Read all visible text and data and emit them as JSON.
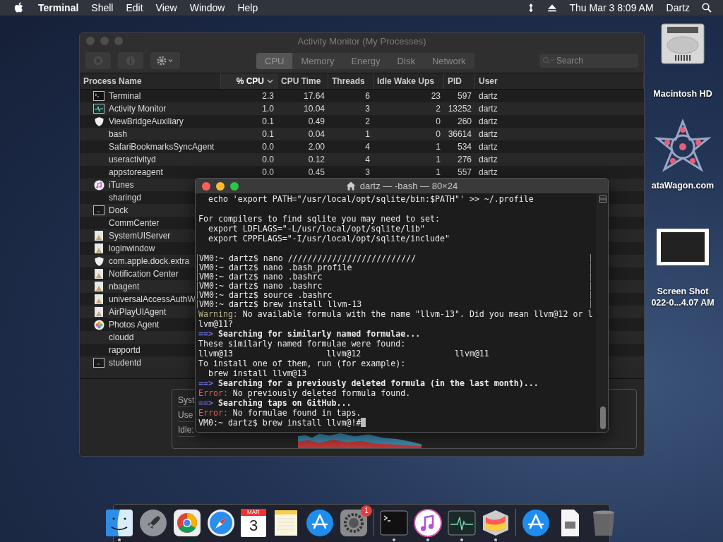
{
  "menu_bar": {
    "app_name": "Terminal",
    "menus": [
      "Shell",
      "Edit",
      "View",
      "Window",
      "Help"
    ],
    "clock": "Thu Mar 3  8:09 AM",
    "user": "Dartz"
  },
  "activity_monitor": {
    "title": "Activity Monitor (My Processes)",
    "tabs": [
      {
        "label": "CPU",
        "selected": true
      },
      {
        "label": "Memory",
        "selected": false
      },
      {
        "label": "Energy",
        "selected": false
      },
      {
        "label": "Disk",
        "selected": false
      },
      {
        "label": "Network",
        "selected": false
      }
    ],
    "search": {
      "placeholder": "Search"
    },
    "columns": [
      {
        "label": "Process Name",
        "sorted": false
      },
      {
        "label": "% CPU",
        "sorted": true
      },
      {
        "label": "CPU Time",
        "sorted": false
      },
      {
        "label": "Threads",
        "sorted": false
      },
      {
        "label": "Idle Wake Ups",
        "sorted": false
      },
      {
        "label": "PID",
        "sorted": false
      },
      {
        "label": "User",
        "sorted": false
      }
    ],
    "rows": [
      {
        "name": "Terminal",
        "kind": "terminal",
        "cells": [
          "2.3",
          "17.64",
          "6",
          "23",
          "597",
          "dartz"
        ]
      },
      {
        "name": "Activity Monitor",
        "kind": "activity",
        "cells": [
          "1.0",
          "10.04",
          "3",
          "2",
          "13252",
          "dartz"
        ]
      },
      {
        "name": "ViewBridgeAuxiliary",
        "kind": "shield",
        "cells": [
          "0.1",
          "0.49",
          "2",
          "0",
          "260",
          "dartz"
        ]
      },
      {
        "name": "bash",
        "kind": "none",
        "cells": [
          "0.1",
          "0.04",
          "1",
          "0",
          "36614",
          "dartz"
        ]
      },
      {
        "name": "SafariBookmarksSyncAgent",
        "kind": "none",
        "cells": [
          "0.0",
          "2.00",
          "4",
          "1",
          "534",
          "dartz"
        ]
      },
      {
        "name": "useractivityd",
        "kind": "none",
        "cells": [
          "0.0",
          "0.12",
          "4",
          "1",
          "276",
          "dartz"
        ]
      },
      {
        "name": "appstoreagent",
        "kind": "none",
        "cells": [
          "0.0",
          "0.45",
          "3",
          "1",
          "557",
          "dartz"
        ]
      },
      {
        "name": "iTunes",
        "kind": "music"
      },
      {
        "name": "sharingd",
        "kind": "none"
      },
      {
        "name": "Dock",
        "kind": "window"
      },
      {
        "name": "CommCenter",
        "kind": "none"
      },
      {
        "name": "SystemUIServer",
        "kind": "app"
      },
      {
        "name": "loginwindow",
        "kind": "app"
      },
      {
        "name": "com.apple.dock.extra",
        "kind": "shield"
      },
      {
        "name": "Notification Center",
        "kind": "app"
      },
      {
        "name": "nbagent",
        "kind": "app"
      },
      {
        "name": "universalAccessAuthW",
        "kind": "app"
      },
      {
        "name": "AirPlayUIAgent",
        "kind": "app"
      },
      {
        "name": "Photos Agent",
        "kind": "photos"
      },
      {
        "name": "cloudd",
        "kind": "none"
      },
      {
        "name": "rapportd",
        "kind": "none"
      },
      {
        "name": "studentd",
        "kind": "window"
      }
    ],
    "summary_labels": [
      "Syst",
      "Use",
      "Idle:"
    ]
  },
  "terminal": {
    "title": "dartz — -bash — 80×24",
    "lines": [
      {
        "kind": "text",
        "marked": false,
        "segments": [
          {
            "text": "  echo 'export PATH=\"/usr/local/opt/sqlite/bin:$PATH\"' >> ~/.profile",
            "kind": "plain"
          }
        ]
      },
      {
        "kind": "blank"
      },
      {
        "kind": "text",
        "marked": false,
        "segments": [
          {
            "text": "For compilers to find sqlite you may need to set:",
            "kind": "plain"
          }
        ]
      },
      {
        "kind": "text",
        "marked": false,
        "segments": [
          {
            "text": "  export LDFLAGS=\"-L/usr/local/opt/sqlite/lib\"",
            "kind": "plain"
          }
        ]
      },
      {
        "kind": "text",
        "marked": false,
        "segments": [
          {
            "text": "  export CPPFLAGS=\"-I/usr/local/opt/sqlite/include\"",
            "kind": "plain"
          }
        ]
      },
      {
        "kind": "blank"
      },
      {
        "kind": "text",
        "marked": true,
        "segments": [
          {
            "text": "VM0:~ dartz$ nano //////////////////////////",
            "kind": "plain"
          }
        ]
      },
      {
        "kind": "text",
        "marked": true,
        "segments": [
          {
            "text": "VM0:~ dartz$ nano .bash_profile",
            "kind": "plain"
          }
        ]
      },
      {
        "kind": "text",
        "marked": true,
        "segments": [
          {
            "text": "VM0:~ dartz$ nano .bashrc",
            "kind": "plain"
          }
        ]
      },
      {
        "kind": "text",
        "marked": true,
        "segments": [
          {
            "text": "VM0:~ dartz$ nano .bashrc",
            "kind": "plain"
          }
        ]
      },
      {
        "kind": "text",
        "marked": true,
        "segments": [
          {
            "text": "VM0:~ dartz$ source .bashrc",
            "kind": "plain"
          }
        ]
      },
      {
        "kind": "text",
        "marked": true,
        "segments": [
          {
            "text": "VM0:~ dartz$ brew install llvm-13",
            "kind": "plain"
          }
        ]
      },
      {
        "kind": "text",
        "marked": false,
        "segments": [
          {
            "text": "Warning:",
            "kind": "warning"
          },
          {
            "text": " No available formula with the name \"llvm-13\". Did you mean llvm@12 or l",
            "kind": "plain"
          }
        ]
      },
      {
        "kind": "text",
        "marked": false,
        "segments": [
          {
            "text": "lvm@11?",
            "kind": "plain"
          }
        ]
      },
      {
        "kind": "text",
        "marked": false,
        "segments": [
          {
            "text": "==>",
            "kind": "arrow"
          },
          {
            "text": " Searching for similarly named formulae...",
            "kind": "bold"
          }
        ]
      },
      {
        "kind": "text",
        "marked": false,
        "segments": [
          {
            "text": "These similarly named formulae were found:",
            "kind": "plain"
          }
        ]
      },
      {
        "kind": "text",
        "marked": false,
        "segments": [
          {
            "text": "llvm@13                   llvm@12                   llvm@11",
            "kind": "plain"
          }
        ]
      },
      {
        "kind": "text",
        "marked": false,
        "segments": [
          {
            "text": "To install one of them, run (for example):",
            "kind": "plain"
          }
        ]
      },
      {
        "kind": "text",
        "marked": false,
        "segments": [
          {
            "text": "  brew install llvm@13",
            "kind": "plain"
          }
        ]
      },
      {
        "kind": "text",
        "marked": false,
        "segments": [
          {
            "text": "==>",
            "kind": "arrow"
          },
          {
            "text": " Searching for a previously deleted formula (in the last month)...",
            "kind": "bold"
          }
        ]
      },
      {
        "kind": "text",
        "marked": false,
        "segments": [
          {
            "text": "Error:",
            "kind": "error"
          },
          {
            "text": " No previously deleted formula found.",
            "kind": "plain"
          }
        ]
      },
      {
        "kind": "text",
        "marked": false,
        "segments": [
          {
            "text": "==>",
            "kind": "arrow"
          },
          {
            "text": " Searching taps on GitHub...",
            "kind": "bold"
          }
        ]
      },
      {
        "kind": "text",
        "marked": false,
        "segments": [
          {
            "text": "Error:",
            "kind": "error"
          },
          {
            "text": " No formulae found in taps.",
            "kind": "plain"
          }
        ]
      },
      {
        "kind": "prompt",
        "marked": false,
        "segments": [
          {
            "text": "VM0:~ dartz$ brew install llvm@!#",
            "kind": "plain"
          }
        ]
      }
    ]
  },
  "desktop_icons": [
    {
      "kind": "drive",
      "label": "Macintosh HD"
    },
    {
      "kind": "star",
      "label": "ataWagon.com"
    },
    {
      "kind": "screenshot",
      "label": "Screen Shot",
      "sublabel": "022-0...4.07 AM"
    }
  ],
  "dock": {
    "items": [
      {
        "kind": "finder",
        "running": true
      },
      {
        "kind": "rocket",
        "running": false
      },
      {
        "kind": "browser",
        "running": false
      },
      {
        "kind": "compass",
        "running": false
      },
      {
        "kind": "calendar",
        "running": false,
        "month": "MAR",
        "day": "3"
      },
      {
        "kind": "notes",
        "running": false
      },
      {
        "kind": "appstore",
        "running": false
      },
      {
        "kind": "gear",
        "running": false,
        "badge": "1"
      },
      {
        "kind": "separator"
      },
      {
        "kind": "terminal",
        "running": true
      },
      {
        "kind": "music",
        "running": true
      },
      {
        "kind": "monitor",
        "running": true
      },
      {
        "kind": "grapher",
        "running": true
      },
      {
        "kind": "separator"
      },
      {
        "kind": "appstore",
        "running": false
      },
      {
        "kind": "document",
        "running": false
      },
      {
        "kind": "trash",
        "running": false
      }
    ]
  }
}
